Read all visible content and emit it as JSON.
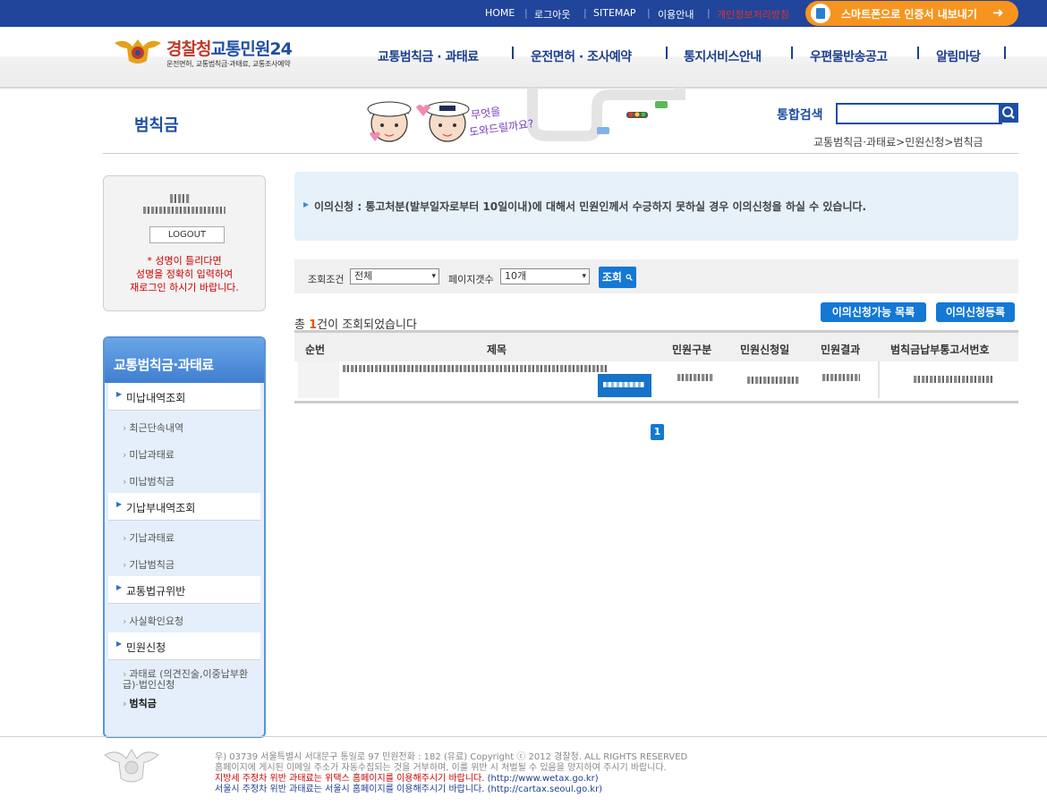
{
  "topbar": {
    "links": [
      "HOME",
      "로그아웃",
      "SITEMAP",
      "이용안내",
      "개인정보처리방침"
    ],
    "smart_label": "스마트폰으로 인증서 내보내기",
    "smart_arrow": "➜"
  },
  "header": {
    "logo_title_red": "경찰청",
    "logo_title_blue": "교통민원24",
    "logo_sub": "운전면허, 교통범칙금·과태료, 교통조사예약",
    "nav": [
      "교통범칙금 · 과태료",
      "운전면허 · 조사예약",
      "통지서비스안내",
      "우편물반송공고",
      "알림마당"
    ]
  },
  "page": {
    "title": "범칙금",
    "search_label": "통합검색",
    "search_placeholder": "",
    "breadcrumb": "교통범칙금·과태료>민원신청>범칙금",
    "mascot_text_1": "무엇을",
    "mascot_text_2": "도와드릴까요?"
  },
  "login": {
    "logout_label": "LOGOUT",
    "warn_line1": "* 성명이 틀리다면",
    "warn_line2": "성명을 정확히 입력하여",
    "warn_line3": "재로그인 하시기 바랍니다."
  },
  "sidenav": {
    "header": "교통범칙금·과태료",
    "marker": "›",
    "group1": "미납내역조회",
    "g1_items": [
      "최근단속내역",
      "미납과태료",
      "미납범칙금"
    ],
    "group2": "기납부내역조회",
    "g2_items": [
      "기납과태료",
      "기납범칙금"
    ],
    "group3": "교통법규위반",
    "g3_items": [
      "사실확인요청"
    ],
    "group4": "민원신청",
    "g4_item1_line1": "과태료 (의견진술,이중납부환",
    "g4_item1_line2": "급)·법인신청",
    "g4_item2": "범칙금"
  },
  "notice": {
    "marker": "▶",
    "text": "이의신청 : 통고처분(발부일자로부터 10일이내)에 대해서 민원인께서 수긍하지 못하실 경우 이의신청을 하실 수 있습니다."
  },
  "filter": {
    "condition_label": "조회조건",
    "condition_value": "전체",
    "page_size_label": "페이지갯수",
    "page_size_value": "10개",
    "query_label": "조회",
    "caret": "▾"
  },
  "results": {
    "prefix": "총 ",
    "count": "1",
    "suffix": "건이 조회되었습니다",
    "btn_list": "이의신청가능 목록",
    "btn_register": "이의신청등록"
  },
  "table": {
    "columns": [
      "순번",
      "제목",
      "민원구분",
      "민원신청일",
      "민원결과",
      "범칙금납부통고서번호"
    ]
  },
  "pager": {
    "current": "1"
  },
  "footer": {
    "line1": "우) 03739 서울특별시 서대문구 통일로 97  민원전화 : 182 (유료)       Copyright ⓒ 2012 경찰청. ALL RIGHTS RESERVED",
    "line2": "홈페이지에 게시된 이메일 주소가 자동수집되는 것을 거부하며, 이를 위반 시 처벌될 수 있음을 양지하여 주시기 바랍니다.",
    "line3_a": "지방세 주정차 위반 과태료는 위택스 홈페이지를 이용해주시기 바랍니다.",
    "line3_b": " (http://www.wetax.go.kr)",
    "line4_a": "서울시 주정차 위반 과태료는 서울시 홈페이지를 이용해주시기 바랍니다.",
    "line4_b": " (http://cartax.seoul.go.kr)"
  },
  "colors": {
    "brand_blue": "#20459a",
    "accent_orange": "#f7941d",
    "button_blue": "#1478d4",
    "warn_red": "#cc0000"
  }
}
